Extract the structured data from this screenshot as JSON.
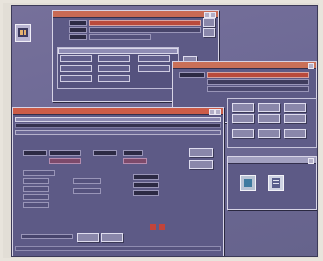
{
  "desktop": {
    "icon_name": "application-icon"
  },
  "windows": {
    "top": {
      "title": ""
    },
    "mid": {
      "title": ""
    },
    "front": {
      "title": ""
    },
    "small": {
      "title": ""
    }
  },
  "colors": {
    "desktop": "#6e6a96",
    "window": "#5d5a86",
    "titlebar_active": "#c86a55",
    "field": "#3a3756",
    "field_red": "#b94a3c"
  }
}
